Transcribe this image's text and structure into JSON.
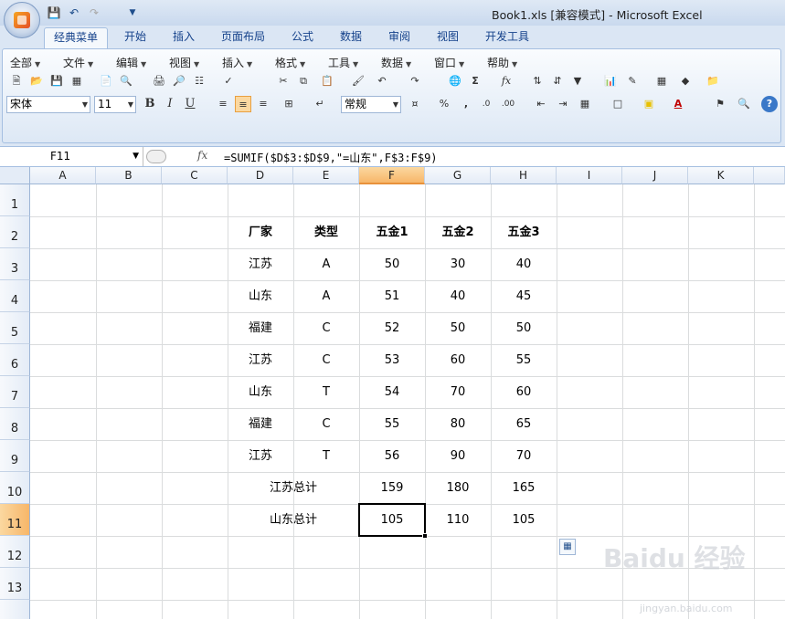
{
  "window": {
    "title": "Book1.xls  [兼容模式] - Microsoft Excel"
  },
  "tabs": [
    "经典菜单",
    "开始",
    "插入",
    "页面布局",
    "公式",
    "数据",
    "审阅",
    "视图",
    "开发工具"
  ],
  "menus": [
    "全部",
    "文件",
    "编辑",
    "视图",
    "插入",
    "格式",
    "工具",
    "数据",
    "窗口",
    "帮助"
  ],
  "toolbar": {
    "font_name": "宋体",
    "font_size": "11",
    "number_format": "常规",
    "bold": "B",
    "italic": "I",
    "underline": "U",
    "percent": "%",
    "comma": ",",
    "sigma": "Σ",
    "fx": "fx"
  },
  "formula_bar": {
    "name_box": "F11",
    "fx_label": "fx",
    "formula": "=SUMIF($D$3:$D$9,\"=山东\",F$3:F$9)"
  },
  "sheet": {
    "columns": [
      "A",
      "B",
      "C",
      "D",
      "E",
      "F",
      "G",
      "H",
      "I",
      "J",
      "K"
    ],
    "rows": [
      "1",
      "2",
      "3",
      "4",
      "5",
      "6",
      "7",
      "8",
      "9",
      "10",
      "11",
      "12",
      "13"
    ],
    "header": {
      "d": "厂家",
      "e": "类型",
      "f": "五金1",
      "g": "五金2",
      "h": "五金3"
    },
    "data": [
      {
        "d": "江苏",
        "e": "A",
        "f": "50",
        "g": "30",
        "h": "40"
      },
      {
        "d": "山东",
        "e": "A",
        "f": "51",
        "g": "40",
        "h": "45"
      },
      {
        "d": "福建",
        "e": "C",
        "f": "52",
        "g": "50",
        "h": "50"
      },
      {
        "d": "江苏",
        "e": "C",
        "f": "53",
        "g": "60",
        "h": "55"
      },
      {
        "d": "山东",
        "e": "T",
        "f": "54",
        "g": "70",
        "h": "60"
      },
      {
        "d": "福建",
        "e": "C",
        "f": "55",
        "g": "80",
        "h": "65"
      },
      {
        "d": "江苏",
        "e": "T",
        "f": "56",
        "g": "90",
        "h": "70"
      }
    ],
    "totals": [
      {
        "label": "江苏总计",
        "f": "159",
        "g": "180",
        "h": "165"
      },
      {
        "label": "山东总计",
        "f": "105",
        "g": "110",
        "h": "105"
      }
    ],
    "active_cell": "F11"
  },
  "watermark": {
    "main": "Baidu 经验",
    "sub": "jingyan.baidu.com"
  }
}
